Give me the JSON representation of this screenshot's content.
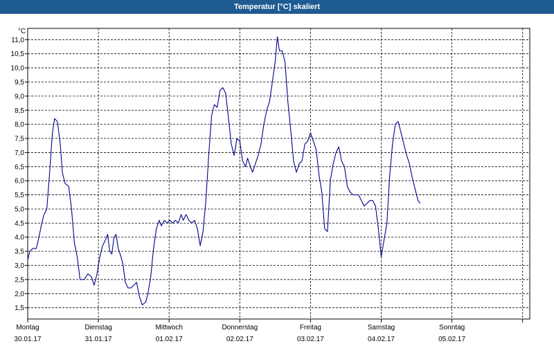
{
  "window": {
    "title": "Temperatur [°C] skaliert"
  },
  "chart_data": {
    "type": "line",
    "title": "Temperatur [°C] skaliert",
    "ylabel": "°C",
    "ylim": [
      1.1,
      11.4
    ],
    "xlim": [
      0,
      7
    ],
    "grid": true,
    "yticks": [
      1.5,
      2.0,
      2.5,
      3.0,
      3.5,
      4.0,
      4.5,
      5.0,
      5.5,
      6.0,
      6.5,
      7.0,
      7.5,
      8.0,
      8.5,
      9.0,
      9.5,
      10.0,
      10.5,
      11.0
    ],
    "ytick_labels": [
      "1,5",
      "2,0",
      "2,5",
      "3,0",
      "3,5",
      "4,0",
      "4,5",
      "5,0",
      "5,5",
      "6,0",
      "6,5",
      "7,0",
      "7,5",
      "8,0",
      "8,5",
      "9,0",
      "9,5",
      "10,0",
      "10,5",
      "11,0"
    ],
    "xticks": [
      {
        "x": 0,
        "day": "Montag",
        "date": "30.01.17"
      },
      {
        "x": 1,
        "day": "Dienstag",
        "date": "31.01.17"
      },
      {
        "x": 2,
        "day": "Mittwoch",
        "date": "01.02.17"
      },
      {
        "x": 3,
        "day": "Donnerstag",
        "date": "02.02.17"
      },
      {
        "x": 4,
        "day": "Freitag",
        "date": "03.02.17"
      },
      {
        "x": 5,
        "day": "Samstag",
        "date": "04.02.17"
      },
      {
        "x": 6,
        "day": "Sonntag",
        "date": "05.02.17"
      }
    ],
    "series": [
      {
        "color": "#00008b",
        "points": [
          [
            0.0,
            3.2
          ],
          [
            0.03,
            3.5
          ],
          [
            0.07,
            3.6
          ],
          [
            0.12,
            3.6
          ],
          [
            0.15,
            3.9
          ],
          [
            0.2,
            4.5
          ],
          [
            0.23,
            4.8
          ],
          [
            0.27,
            5.0
          ],
          [
            0.31,
            6.3
          ],
          [
            0.35,
            7.7
          ],
          [
            0.38,
            8.2
          ],
          [
            0.42,
            8.1
          ],
          [
            0.46,
            7.3
          ],
          [
            0.49,
            6.3
          ],
          [
            0.53,
            5.9
          ],
          [
            0.58,
            5.8
          ],
          [
            0.62,
            5.0
          ],
          [
            0.66,
            3.8
          ],
          [
            0.7,
            3.3
          ],
          [
            0.74,
            2.5
          ],
          [
            0.8,
            2.5
          ],
          [
            0.85,
            2.7
          ],
          [
            0.9,
            2.6
          ],
          [
            0.94,
            2.3
          ],
          [
            0.98,
            2.7
          ],
          [
            1.02,
            3.3
          ],
          [
            1.06,
            3.7
          ],
          [
            1.1,
            3.9
          ],
          [
            1.13,
            4.1
          ],
          [
            1.16,
            3.5
          ],
          [
            1.19,
            3.4
          ],
          [
            1.22,
            4.0
          ],
          [
            1.25,
            4.1
          ],
          [
            1.28,
            3.6
          ],
          [
            1.32,
            3.3
          ],
          [
            1.35,
            3.0
          ],
          [
            1.38,
            2.4
          ],
          [
            1.42,
            2.2
          ],
          [
            1.46,
            2.2
          ],
          [
            1.5,
            2.3
          ],
          [
            1.54,
            2.4
          ],
          [
            1.58,
            1.9
          ],
          [
            1.62,
            1.6
          ],
          [
            1.67,
            1.7
          ],
          [
            1.7,
            2.0
          ],
          [
            1.74,
            2.6
          ],
          [
            1.78,
            3.6
          ],
          [
            1.82,
            4.3
          ],
          [
            1.86,
            4.6
          ],
          [
            1.89,
            4.4
          ],
          [
            1.93,
            4.6
          ],
          [
            1.97,
            4.5
          ],
          [
            2.01,
            4.6
          ],
          [
            2.05,
            4.5
          ],
          [
            2.09,
            4.6
          ],
          [
            2.13,
            4.5
          ],
          [
            2.17,
            4.8
          ],
          [
            2.2,
            4.6
          ],
          [
            2.24,
            4.8
          ],
          [
            2.28,
            4.6
          ],
          [
            2.32,
            4.5
          ],
          [
            2.36,
            4.6
          ],
          [
            2.4,
            4.3
          ],
          [
            2.44,
            3.7
          ],
          [
            2.48,
            4.2
          ],
          [
            2.52,
            5.3
          ],
          [
            2.56,
            6.9
          ],
          [
            2.6,
            8.3
          ],
          [
            2.64,
            8.7
          ],
          [
            2.68,
            8.6
          ],
          [
            2.72,
            9.2
          ],
          [
            2.76,
            9.3
          ],
          [
            2.8,
            9.1
          ],
          [
            2.84,
            8.2
          ],
          [
            2.88,
            7.3
          ],
          [
            2.92,
            6.9
          ],
          [
            2.96,
            7.5
          ],
          [
            3.0,
            7.4
          ],
          [
            3.04,
            6.7
          ],
          [
            3.08,
            6.5
          ],
          [
            3.11,
            6.8
          ],
          [
            3.15,
            6.5
          ],
          [
            3.18,
            6.3
          ],
          [
            3.22,
            6.6
          ],
          [
            3.26,
            6.9
          ],
          [
            3.3,
            7.3
          ],
          [
            3.34,
            8.0
          ],
          [
            3.38,
            8.5
          ],
          [
            3.42,
            8.8
          ],
          [
            3.46,
            9.5
          ],
          [
            3.5,
            10.2
          ],
          [
            3.53,
            11.1
          ],
          [
            3.56,
            10.6
          ],
          [
            3.6,
            10.6
          ],
          [
            3.64,
            10.2
          ],
          [
            3.68,
            8.8
          ],
          [
            3.72,
            7.8
          ],
          [
            3.76,
            6.7
          ],
          [
            3.8,
            6.3
          ],
          [
            3.84,
            6.6
          ],
          [
            3.88,
            6.7
          ],
          [
            3.92,
            7.3
          ],
          [
            3.96,
            7.4
          ],
          [
            4.0,
            7.7
          ],
          [
            4.04,
            7.4
          ],
          [
            4.08,
            7.1
          ],
          [
            4.12,
            6.2
          ],
          [
            4.16,
            5.6
          ],
          [
            4.2,
            4.3
          ],
          [
            4.24,
            4.2
          ],
          [
            4.28,
            6.0
          ],
          [
            4.32,
            6.6
          ],
          [
            4.36,
            7.0
          ],
          [
            4.4,
            7.2
          ],
          [
            4.44,
            6.7
          ],
          [
            4.48,
            6.5
          ],
          [
            4.52,
            5.8
          ],
          [
            4.56,
            5.6
          ],
          [
            4.6,
            5.5
          ],
          [
            4.64,
            5.5
          ],
          [
            4.68,
            5.5
          ],
          [
            4.72,
            5.3
          ],
          [
            4.76,
            5.1
          ],
          [
            4.8,
            5.2
          ],
          [
            4.84,
            5.3
          ],
          [
            4.88,
            5.3
          ],
          [
            4.92,
            5.1
          ],
          [
            4.96,
            4.3
          ],
          [
            5.0,
            3.3
          ],
          [
            5.04,
            3.9
          ],
          [
            5.08,
            4.5
          ],
          [
            5.12,
            6.2
          ],
          [
            5.16,
            7.3
          ],
          [
            5.2,
            8.0
          ],
          [
            5.24,
            8.1
          ],
          [
            5.28,
            7.7
          ],
          [
            5.32,
            7.3
          ],
          [
            5.36,
            6.9
          ],
          [
            5.4,
            6.6
          ],
          [
            5.44,
            6.1
          ],
          [
            5.48,
            5.7
          ],
          [
            5.52,
            5.3
          ],
          [
            5.55,
            5.2
          ]
        ]
      }
    ]
  }
}
